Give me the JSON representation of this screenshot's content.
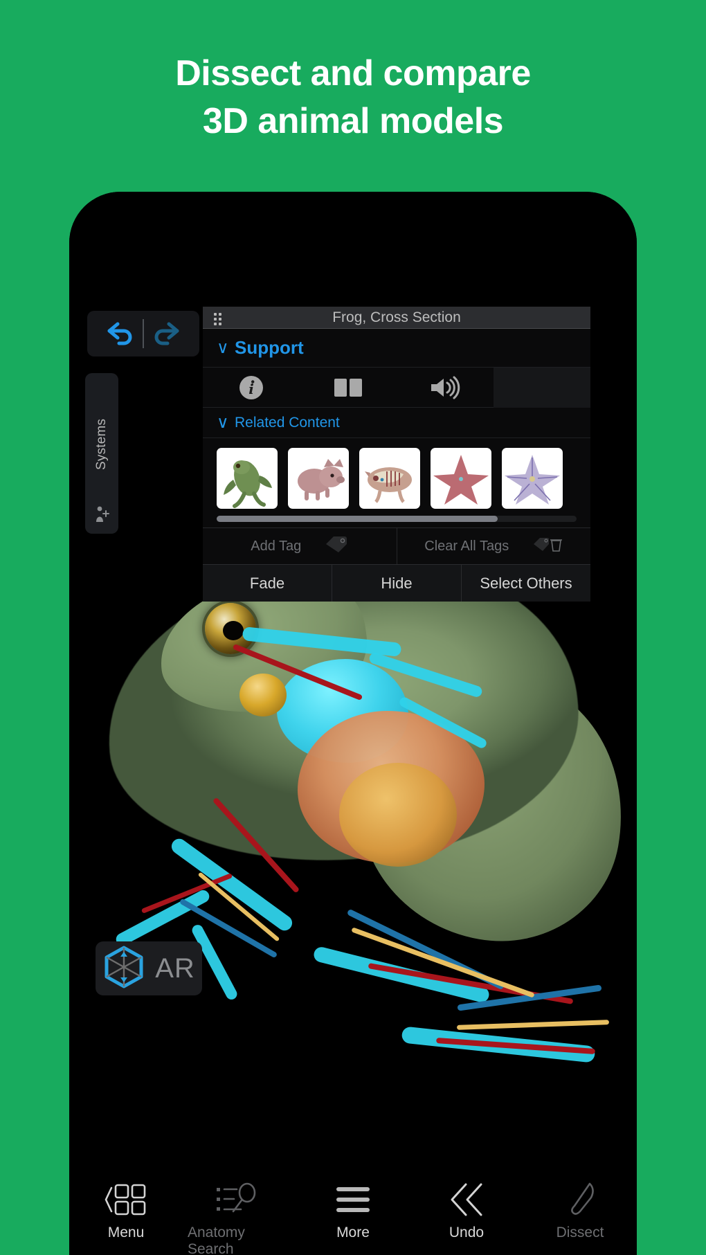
{
  "marketing": {
    "headline": "Dissect and compare\n3D animal models",
    "background_color": "#18ab5e",
    "text_color": "#ffffff"
  },
  "app": {
    "accent_color": "#2196e8",
    "panel_background": "#0a0a0b",
    "toolbar": {
      "undo_label": "undo-arrow",
      "redo_label": "redo-arrow"
    },
    "systems_rail": {
      "label": "Systems",
      "bottom_icon": "add-person-icon"
    },
    "info_panel": {
      "title": "Frog, Cross Section",
      "grip": "drag-grip-icon",
      "sections": [
        {
          "label": "Support",
          "chevron": "∨",
          "expanded": true
        },
        {
          "label": "Related Content",
          "chevron": "∨",
          "expanded": true
        }
      ],
      "media_icons": [
        {
          "name": "info-icon",
          "glyph": "i"
        },
        {
          "name": "book-icon",
          "glyph": "book"
        },
        {
          "name": "speaker-icon",
          "glyph": "speaker"
        }
      ],
      "related_content": [
        {
          "name": "Frog",
          "kind": "frog-thumbnail"
        },
        {
          "name": "Pig",
          "kind": "pig-thumbnail"
        },
        {
          "name": "Pig, Cross Section",
          "kind": "pig-dissected-thumbnail"
        },
        {
          "name": "Starfish",
          "kind": "starfish-thumbnail"
        },
        {
          "name": "Starfish, Cross Section",
          "kind": "starfish-dissected-thumbnail"
        }
      ],
      "scroll_position_percent": 78,
      "tag_buttons": [
        {
          "label": "Add Tag",
          "icon": "tag-icon",
          "enabled": false
        },
        {
          "label": "Clear All Tags",
          "icon": "tag-trash-icon",
          "enabled": false
        }
      ],
      "action_buttons": [
        {
          "label": "Fade"
        },
        {
          "label": "Hide"
        },
        {
          "label": "Select Others"
        }
      ]
    },
    "ar_button": {
      "label": "AR",
      "icon": "ar-cube-icon"
    },
    "bottom_nav": [
      {
        "label": "Menu",
        "icon": "grid-menu-icon",
        "active": true
      },
      {
        "label": "Anatomy Search",
        "icon": "search-list-icon",
        "active": false
      },
      {
        "label": "More",
        "icon": "hamburger-icon",
        "active": true
      },
      {
        "label": "Undo",
        "icon": "double-chevron-left-icon",
        "active": true
      },
      {
        "label": "Dissect",
        "icon": "scalpel-icon",
        "active": false
      }
    ]
  }
}
